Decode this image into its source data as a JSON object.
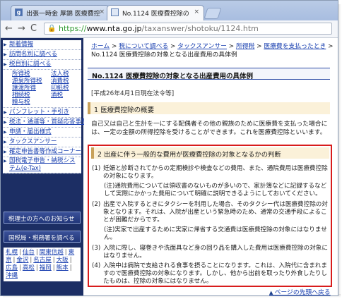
{
  "browser": {
    "tabs": [
      {
        "label": "出張一時金 厚錦 医療費控"
      },
      {
        "label": "No.1124 医療費控除の"
      }
    ],
    "close_glyph": "×",
    "url_prefix": "https://",
    "url_host": "www.nta.go.jp",
    "url_path": "/taxanswer/shotoku/1124.htm",
    "nav": {
      "back": "←",
      "forward": "→",
      "reload": "C",
      "lock": "🔒"
    }
  },
  "sidebar": {
    "items_top": [
      "新着情報",
      "訪問名別に調べる",
      "税目別に調べる"
    ],
    "tax_items": [
      "所得税",
      "法人税",
      "源泉所得税",
      "消費税",
      "譲渡所得",
      "印紙税",
      "相続税",
      "酒税",
      "贈与税"
    ],
    "items_bottom": [
      "パンフレット・手引き",
      "税法・通達等・質疑応答事例",
      "申請・届出様式",
      "タックスアンサー",
      "確定申告書等作成コーナー",
      "国税電子申告・納税システム(e-Tax)"
    ],
    "button_notice": "税理士の方へのお知らせ",
    "button_offices": "国税局・税務署を調べる",
    "offices": [
      "札幌",
      "仙台",
      "関東信越",
      "東京",
      "金沢",
      "名古屋",
      "大阪",
      "広島",
      "高松",
      "福岡",
      "熊本",
      "沖縄"
    ]
  },
  "content": {
    "breadcrumb": {
      "home": "ホーム",
      "tax_lookup": "税について調べる",
      "taxanswer": "タックスアンサー",
      "income_tax": "所得税",
      "medical": "医療費を支払ったとき",
      "current": "No.1124 医療費控除の対象となる出産費用の具体例",
      "sep": ">"
    },
    "title": "No.1124 医療費控除の対象となる出産費用の具体例",
    "date": "[平成26年4月1日現在法令等]",
    "section1": {
      "heading": "1 医療費控除の概要",
      "body": "自己又は自己と生計を一にする配偶者その他の親族のために医療費を支払った場合には、一定の金額の所得控除を受けることができます。これを医療費控除といいます。"
    },
    "section2": {
      "heading": "2 出産に伴う一般的な費用が医療費控除の対象となるかの判断",
      "items": [
        {
          "num": "(1)",
          "text": "妊娠と診断されてからの定期検診や検査などの費用、また、通院費用は医療費控除の対象になります。"
        },
        {
          "num": "",
          "text": "(注)通院費用については領収書のないものが多いので、家計簿などに記録するなどして実際にかかった費用について明確に説明できるようにしておいてください。"
        },
        {
          "num": "(2)",
          "text": "出産で入院するときにタクシーを利用した場合、そのタクシー代は医療費控除の対象となります。それは、入院が出産という緊急時のため、通常の交通手段によることが困難だからです。"
        },
        {
          "num": "",
          "text": "(注)実家で出産するために実家に帰省する交通費は医療費控除の対象にはなりません。"
        },
        {
          "num": "(3)",
          "text": "入院に際し、寝巻きや洗面具など身の回り品を購入した費用は医療費控除の対象にはなりません。"
        },
        {
          "num": "(4)",
          "text": "入院中は病院で支給される食事を摂ることになります。これは、入院代に含まれますので医療費控除の対象になります。しかし、他から出前を取ったり外食したりしたものは、控除の対象にはなりません。"
        }
      ]
    },
    "page_top": "ページの先頭へ戻る"
  }
}
